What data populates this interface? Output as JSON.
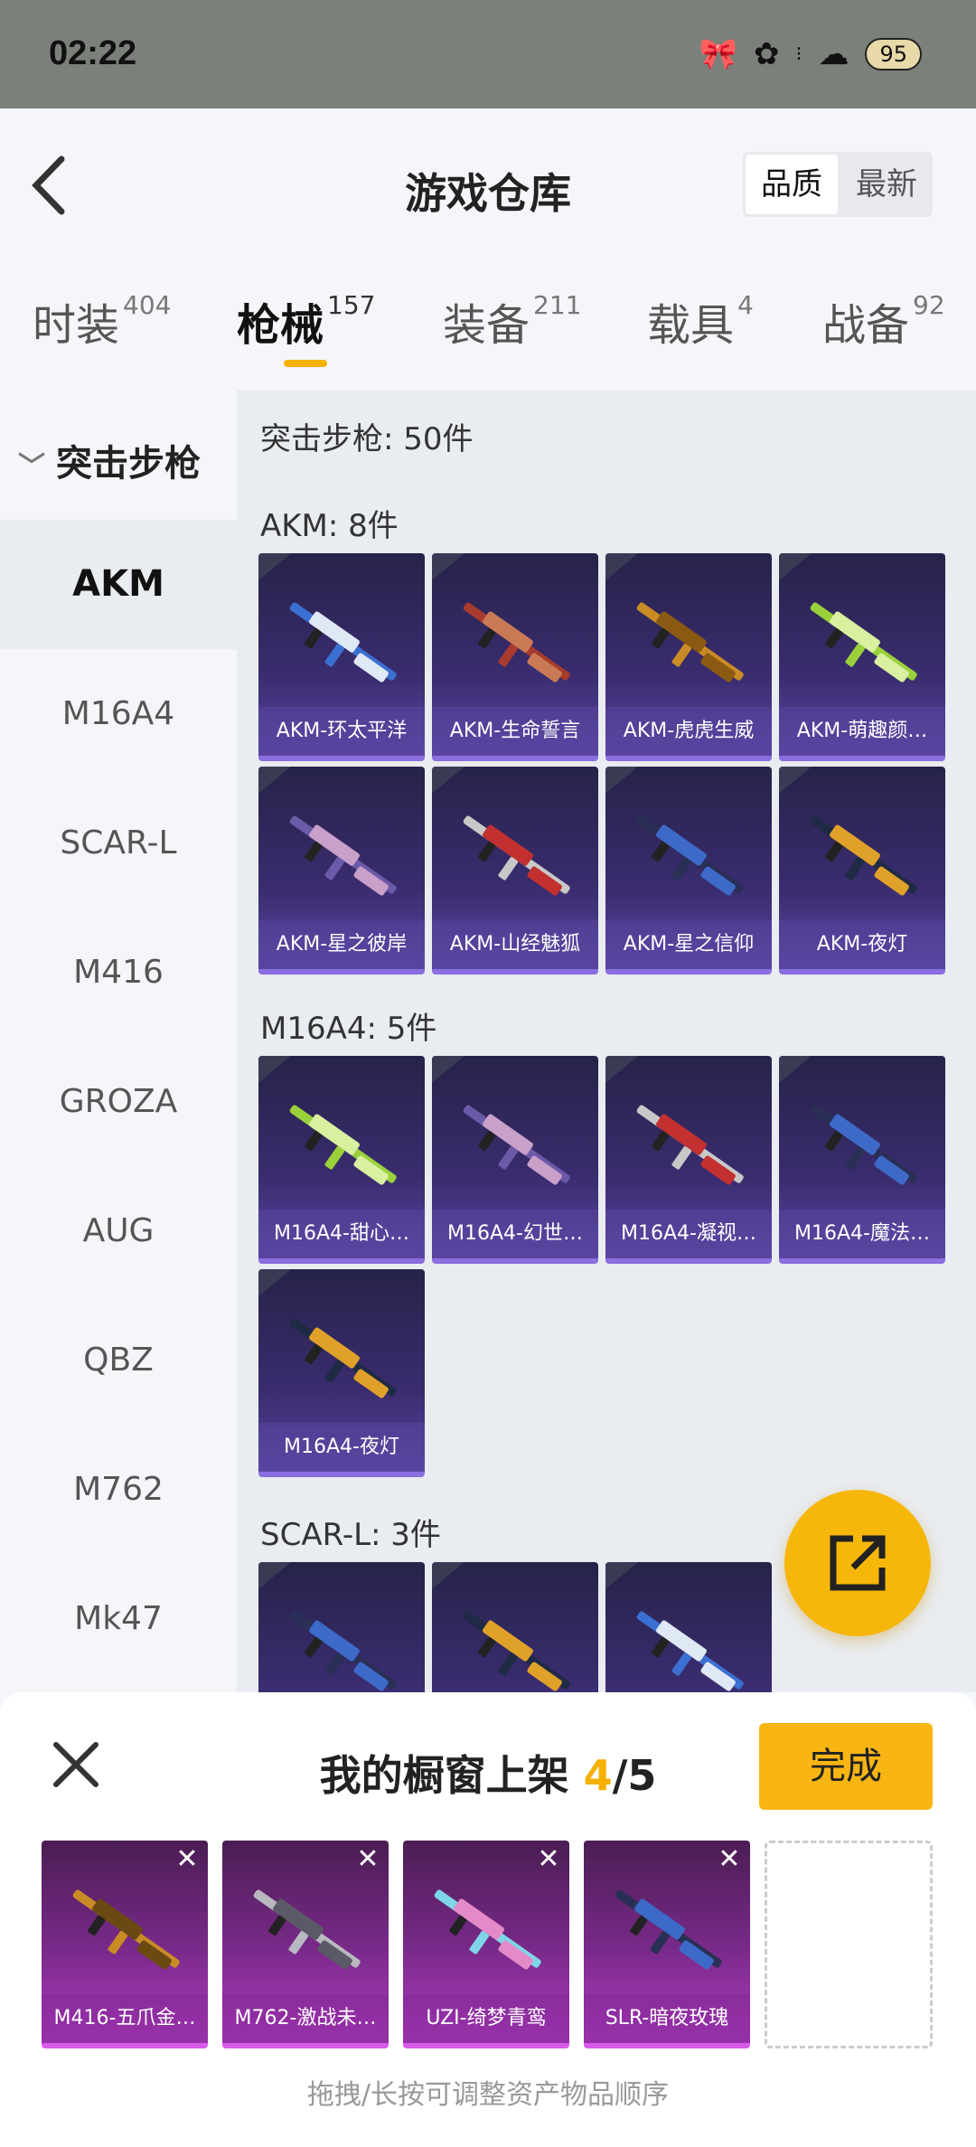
{
  "status": {
    "time": "02:22",
    "battery": "95"
  },
  "header": {
    "title": "游戏仓库",
    "sort_quality": "品质",
    "sort_latest": "最新"
  },
  "tabs": [
    {
      "label": "时装",
      "count": "404"
    },
    {
      "label": "枪械",
      "count": "157"
    },
    {
      "label": "装备",
      "count": "211"
    },
    {
      "label": "载具",
      "count": "4"
    },
    {
      "label": "战备",
      "count": "92"
    }
  ],
  "sidebar": {
    "category": "突击步枪",
    "items": [
      "AKM",
      "M16A4",
      "SCAR-L",
      "M416",
      "GROZA",
      "AUG",
      "QBZ",
      "M762",
      "Mk47"
    ]
  },
  "main": {
    "summary": "突击步枪: 50件",
    "groups": [
      {
        "title": "AKM: 8件",
        "items": [
          "AKM-环太平洋",
          "AKM-生命誓言",
          "AKM-虎虎生威",
          "AKM-萌趣颜…",
          "AKM-星之彼岸",
          "AKM-山经魅狐",
          "AKM-星之信仰",
          "AKM-夜灯"
        ]
      },
      {
        "title": "M16A4: 5件",
        "items": [
          "M16A4-甜心…",
          "M16A4-幻世…",
          "M16A4-凝视…",
          "M16A4-魔法…",
          "M16A4-夜灯"
        ]
      },
      {
        "title": "SCAR-L: 3件",
        "items": [
          "",
          "",
          ""
        ]
      }
    ]
  },
  "showcase": {
    "title_prefix": "我的橱窗上架 ",
    "count": "4",
    "total": "/5",
    "done_label": "完成",
    "slots": [
      "M416-五爪金…",
      "M762-激战未…",
      "UZI-绮梦青鸾",
      "SLR-暗夜玫瑰"
    ],
    "hint": "拖拽/长按可调整资产物品顺序"
  }
}
